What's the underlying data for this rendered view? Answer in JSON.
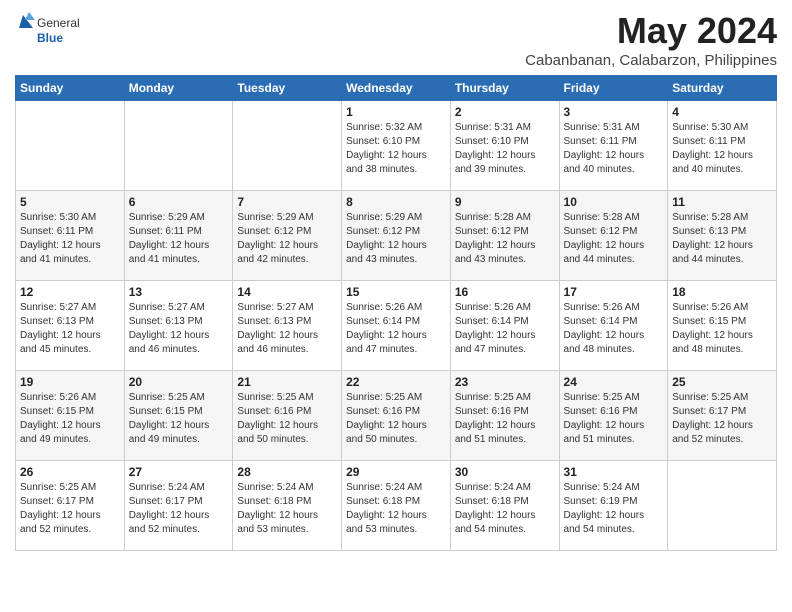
{
  "header": {
    "logo_general": "General",
    "logo_blue": "Blue",
    "month_year": "May 2024",
    "location": "Cabanbanan, Calabarzon, Philippines"
  },
  "weekdays": [
    "Sunday",
    "Monday",
    "Tuesday",
    "Wednesday",
    "Thursday",
    "Friday",
    "Saturday"
  ],
  "weeks": [
    [
      {
        "day": "",
        "sunrise": "",
        "sunset": "",
        "daylight": ""
      },
      {
        "day": "",
        "sunrise": "",
        "sunset": "",
        "daylight": ""
      },
      {
        "day": "",
        "sunrise": "",
        "sunset": "",
        "daylight": ""
      },
      {
        "day": "1",
        "sunrise": "Sunrise: 5:32 AM",
        "sunset": "Sunset: 6:10 PM",
        "daylight": "Daylight: 12 hours and 38 minutes."
      },
      {
        "day": "2",
        "sunrise": "Sunrise: 5:31 AM",
        "sunset": "Sunset: 6:10 PM",
        "daylight": "Daylight: 12 hours and 39 minutes."
      },
      {
        "day": "3",
        "sunrise": "Sunrise: 5:31 AM",
        "sunset": "Sunset: 6:11 PM",
        "daylight": "Daylight: 12 hours and 40 minutes."
      },
      {
        "day": "4",
        "sunrise": "Sunrise: 5:30 AM",
        "sunset": "Sunset: 6:11 PM",
        "daylight": "Daylight: 12 hours and 40 minutes."
      }
    ],
    [
      {
        "day": "5",
        "sunrise": "Sunrise: 5:30 AM",
        "sunset": "Sunset: 6:11 PM",
        "daylight": "Daylight: 12 hours and 41 minutes."
      },
      {
        "day": "6",
        "sunrise": "Sunrise: 5:29 AM",
        "sunset": "Sunset: 6:11 PM",
        "daylight": "Daylight: 12 hours and 41 minutes."
      },
      {
        "day": "7",
        "sunrise": "Sunrise: 5:29 AM",
        "sunset": "Sunset: 6:12 PM",
        "daylight": "Daylight: 12 hours and 42 minutes."
      },
      {
        "day": "8",
        "sunrise": "Sunrise: 5:29 AM",
        "sunset": "Sunset: 6:12 PM",
        "daylight": "Daylight: 12 hours and 43 minutes."
      },
      {
        "day": "9",
        "sunrise": "Sunrise: 5:28 AM",
        "sunset": "Sunset: 6:12 PM",
        "daylight": "Daylight: 12 hours and 43 minutes."
      },
      {
        "day": "10",
        "sunrise": "Sunrise: 5:28 AM",
        "sunset": "Sunset: 6:12 PM",
        "daylight": "Daylight: 12 hours and 44 minutes."
      },
      {
        "day": "11",
        "sunrise": "Sunrise: 5:28 AM",
        "sunset": "Sunset: 6:13 PM",
        "daylight": "Daylight: 12 hours and 44 minutes."
      }
    ],
    [
      {
        "day": "12",
        "sunrise": "Sunrise: 5:27 AM",
        "sunset": "Sunset: 6:13 PM",
        "daylight": "Daylight: 12 hours and 45 minutes."
      },
      {
        "day": "13",
        "sunrise": "Sunrise: 5:27 AM",
        "sunset": "Sunset: 6:13 PM",
        "daylight": "Daylight: 12 hours and 46 minutes."
      },
      {
        "day": "14",
        "sunrise": "Sunrise: 5:27 AM",
        "sunset": "Sunset: 6:13 PM",
        "daylight": "Daylight: 12 hours and 46 minutes."
      },
      {
        "day": "15",
        "sunrise": "Sunrise: 5:26 AM",
        "sunset": "Sunset: 6:14 PM",
        "daylight": "Daylight: 12 hours and 47 minutes."
      },
      {
        "day": "16",
        "sunrise": "Sunrise: 5:26 AM",
        "sunset": "Sunset: 6:14 PM",
        "daylight": "Daylight: 12 hours and 47 minutes."
      },
      {
        "day": "17",
        "sunrise": "Sunrise: 5:26 AM",
        "sunset": "Sunset: 6:14 PM",
        "daylight": "Daylight: 12 hours and 48 minutes."
      },
      {
        "day": "18",
        "sunrise": "Sunrise: 5:26 AM",
        "sunset": "Sunset: 6:15 PM",
        "daylight": "Daylight: 12 hours and 48 minutes."
      }
    ],
    [
      {
        "day": "19",
        "sunrise": "Sunrise: 5:26 AM",
        "sunset": "Sunset: 6:15 PM",
        "daylight": "Daylight: 12 hours and 49 minutes."
      },
      {
        "day": "20",
        "sunrise": "Sunrise: 5:25 AM",
        "sunset": "Sunset: 6:15 PM",
        "daylight": "Daylight: 12 hours and 49 minutes."
      },
      {
        "day": "21",
        "sunrise": "Sunrise: 5:25 AM",
        "sunset": "Sunset: 6:16 PM",
        "daylight": "Daylight: 12 hours and 50 minutes."
      },
      {
        "day": "22",
        "sunrise": "Sunrise: 5:25 AM",
        "sunset": "Sunset: 6:16 PM",
        "daylight": "Daylight: 12 hours and 50 minutes."
      },
      {
        "day": "23",
        "sunrise": "Sunrise: 5:25 AM",
        "sunset": "Sunset: 6:16 PM",
        "daylight": "Daylight: 12 hours and 51 minutes."
      },
      {
        "day": "24",
        "sunrise": "Sunrise: 5:25 AM",
        "sunset": "Sunset: 6:16 PM",
        "daylight": "Daylight: 12 hours and 51 minutes."
      },
      {
        "day": "25",
        "sunrise": "Sunrise: 5:25 AM",
        "sunset": "Sunset: 6:17 PM",
        "daylight": "Daylight: 12 hours and 52 minutes."
      }
    ],
    [
      {
        "day": "26",
        "sunrise": "Sunrise: 5:25 AM",
        "sunset": "Sunset: 6:17 PM",
        "daylight": "Daylight: 12 hours and 52 minutes."
      },
      {
        "day": "27",
        "sunrise": "Sunrise: 5:24 AM",
        "sunset": "Sunset: 6:17 PM",
        "daylight": "Daylight: 12 hours and 52 minutes."
      },
      {
        "day": "28",
        "sunrise": "Sunrise: 5:24 AM",
        "sunset": "Sunset: 6:18 PM",
        "daylight": "Daylight: 12 hours and 53 minutes."
      },
      {
        "day": "29",
        "sunrise": "Sunrise: 5:24 AM",
        "sunset": "Sunset: 6:18 PM",
        "daylight": "Daylight: 12 hours and 53 minutes."
      },
      {
        "day": "30",
        "sunrise": "Sunrise: 5:24 AM",
        "sunset": "Sunset: 6:18 PM",
        "daylight": "Daylight: 12 hours and 54 minutes."
      },
      {
        "day": "31",
        "sunrise": "Sunrise: 5:24 AM",
        "sunset": "Sunset: 6:19 PM",
        "daylight": "Daylight: 12 hours and 54 minutes."
      },
      {
        "day": "",
        "sunrise": "",
        "sunset": "",
        "daylight": ""
      }
    ]
  ]
}
